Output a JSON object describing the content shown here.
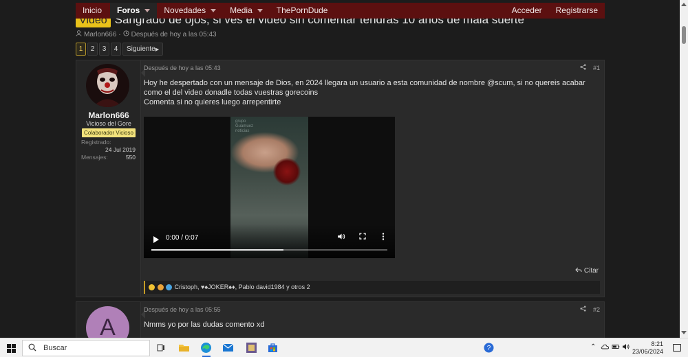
{
  "nav": {
    "items": [
      {
        "label": "Inicio",
        "active": false,
        "caret": false
      },
      {
        "label": "Foros",
        "active": true,
        "caret": true
      },
      {
        "label": "Novedades",
        "active": false,
        "caret": true
      },
      {
        "label": "Media",
        "active": false,
        "caret": true
      },
      {
        "label": "ThePornDude",
        "active": false,
        "caret": false
      }
    ],
    "login": "Acceder",
    "register": "Registrarse"
  },
  "thread": {
    "prefix": "Video",
    "title": "Sangrado de ojos, si ves el video sin comentar tendras 10 años de mala suerte",
    "author": "Marlon666",
    "date": "Después de hoy a las 05:43"
  },
  "pagination": {
    "pages": [
      "1",
      "2",
      "3",
      "4"
    ],
    "current": "1",
    "next": "Siguiente"
  },
  "post1": {
    "username": "Marlon666",
    "user_title": "Vicioso del Gore",
    "banner": "Colaborador Vicioso",
    "registered_label": "Registrado:",
    "registered_value": "24 Jul 2019",
    "messages_label": "Mensajes:",
    "messages_value": "550",
    "date": "Después de hoy a las 05:43",
    "number": "#1",
    "body_line1": "Hoy he despertado con un mensaje de Dios, en 2024 llegara un usuario a esta comunidad de nombre @scum, si no quereis acabar como el del video donadle todas vuestras gorecoins",
    "body_line2": "Comenta si no quieres luego arrepentirte",
    "video": {
      "time": "0:00 / 0:07",
      "progress": 0.56,
      "watermark": "grupo Guamuez noticias"
    },
    "quote": "Citar",
    "reactions_text": "Cristoph, ♥♠JOKER♠♦, Pablo david1984 y otros 2"
  },
  "post2": {
    "avatar_letter": "A",
    "date": "Después de hoy a las 05:55",
    "number": "#2",
    "body": "Nmms yo por las dudas comento xd"
  },
  "taskbar": {
    "search_placeholder": "Buscar",
    "time": "8:21",
    "date": "23/06/2024"
  },
  "colors": {
    "nav_bg": "#5c1010",
    "prefix_bg": "#e9c21a",
    "banner_bg": "#f3e27c",
    "avatar2_bg": "#b080b8"
  }
}
